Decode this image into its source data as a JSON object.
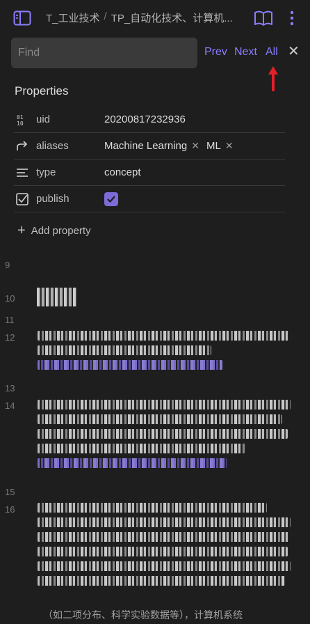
{
  "topbar": {
    "breadcrumb": [
      "T_工业技术",
      "TP_自动化技术、计算机..."
    ],
    "breadcrumb_separator": "/"
  },
  "find": {
    "placeholder": "Find",
    "value": "",
    "prev_label": "Prev",
    "next_label": "Next",
    "all_label": "All",
    "close_label": "✕"
  },
  "properties": {
    "title": "Properties",
    "rows": [
      {
        "icon": "number-icon",
        "key": "uid",
        "value": "20200817232936"
      },
      {
        "icon": "alias-arrow-icon",
        "key": "aliases",
        "values": [
          "Machine Learning",
          "ML"
        ]
      },
      {
        "icon": "text-lines-icon",
        "key": "type",
        "value": "concept"
      },
      {
        "icon": "checkbox-icon",
        "key": "publish",
        "checked": true
      }
    ],
    "add_label": "Add property"
  },
  "line_numbers": [
    "9",
    "10",
    "11",
    "12",
    "13",
    "14",
    "15",
    "16"
  ],
  "footer_text": "（如二项分布、科学实验数据等），计算机系统",
  "colors": {
    "accent": "#8a7dff",
    "background": "#1e1e1e",
    "arrow": "#e0202a"
  }
}
